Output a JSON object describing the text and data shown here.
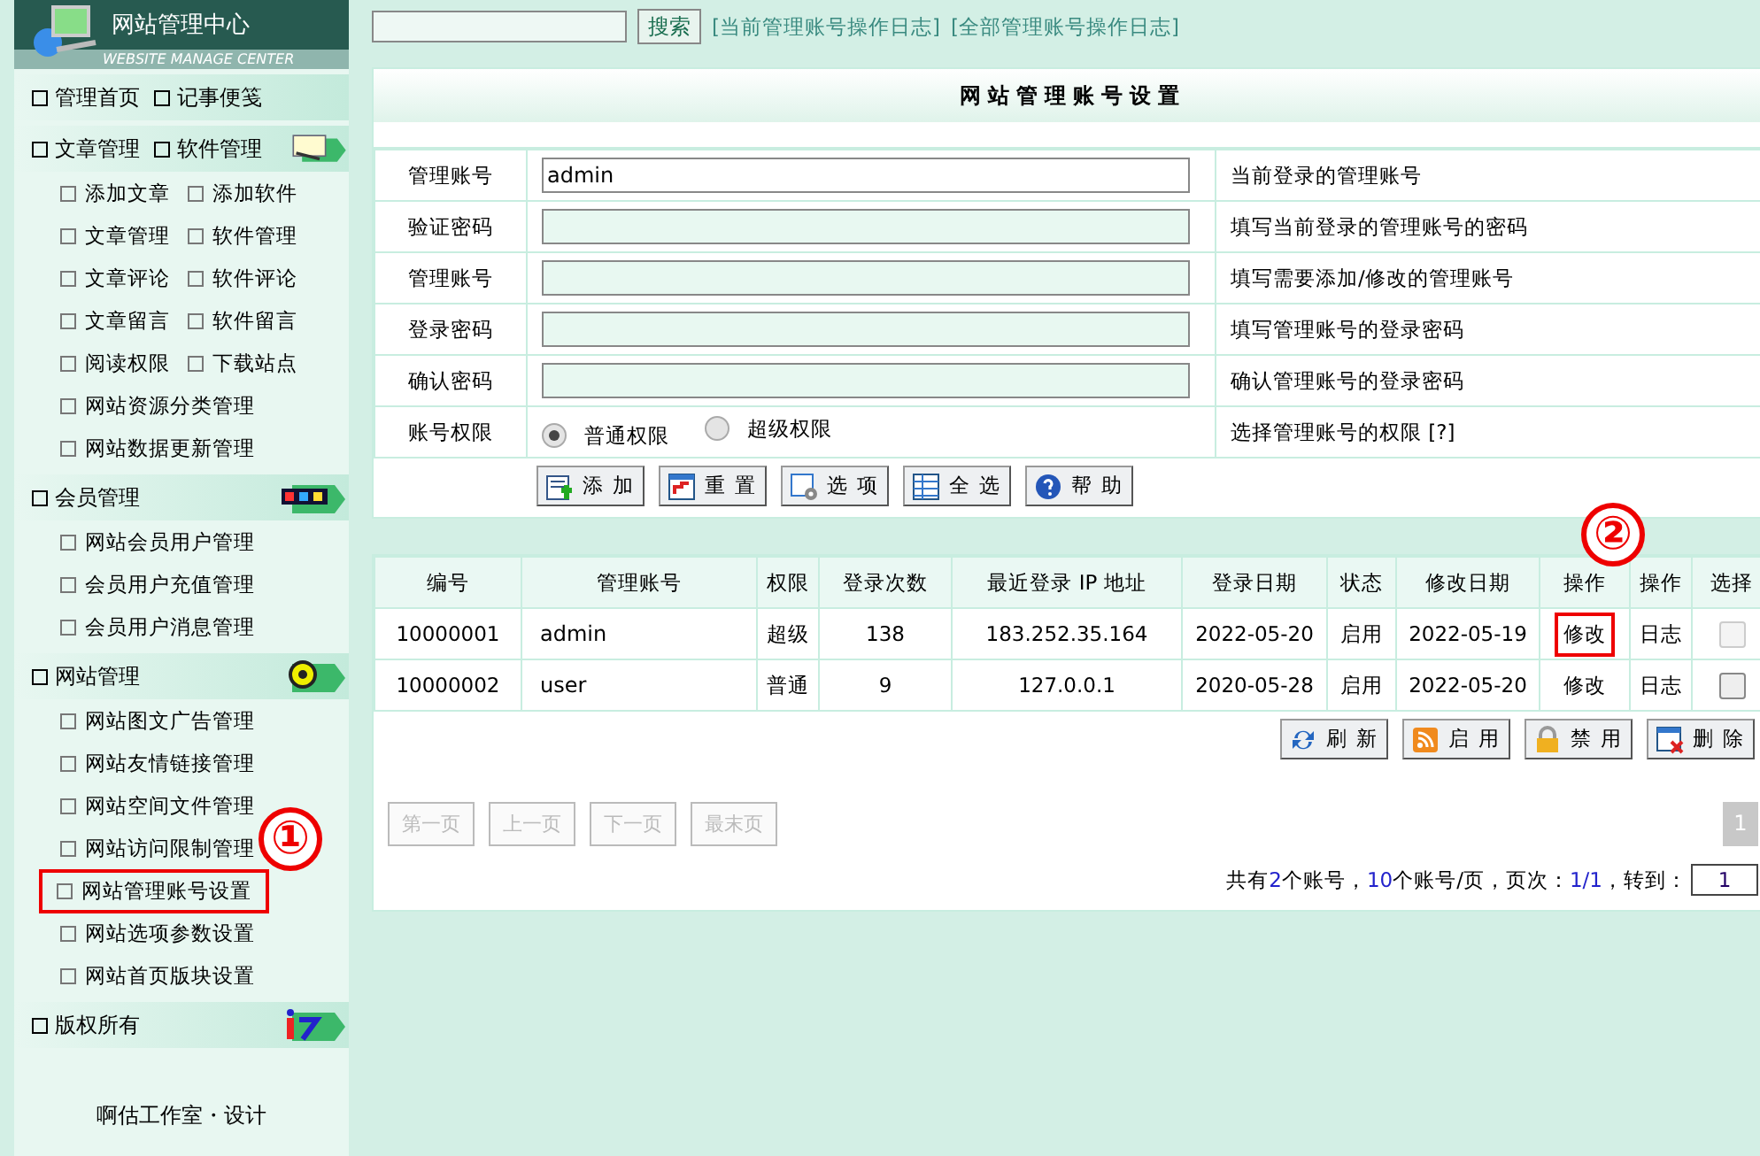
{
  "sidebar": {
    "title": "网站管理中心",
    "subtitle": "WEBSITE MANAGE CENTER",
    "sections": [
      {
        "items": [
          "管理首页",
          "记事便笺"
        ]
      },
      {
        "items": [
          "文章管理",
          "软件管理"
        ],
        "rows": [
          {
            "items": [
              {
                "label": "添加文章",
                "annotated": false
              },
              {
                "label": "添加软件",
                "annotated": false
              }
            ]
          },
          {
            "items": [
              {
                "label": "文章管理",
                "annotated": false
              },
              {
                "label": "软件管理",
                "annotated": false
              }
            ]
          },
          {
            "items": [
              {
                "label": "文章评论",
                "annotated": false
              },
              {
                "label": "软件评论",
                "annotated": false
              }
            ]
          },
          {
            "items": [
              {
                "label": "文章留言",
                "annotated": false
              },
              {
                "label": "软件留言",
                "annotated": false
              }
            ]
          },
          {
            "items": [
              {
                "label": "阅读权限",
                "annotated": false
              },
              {
                "label": "下载站点",
                "annotated": false
              }
            ]
          },
          {
            "items": [
              {
                "label": "网站资源分类管理",
                "annotated": false
              }
            ]
          },
          {
            "items": [
              {
                "label": "网站数据更新管理",
                "annotated": false
              }
            ]
          }
        ]
      },
      {
        "items": [
          "会员管理"
        ],
        "rows": [
          {
            "items": [
              {
                "label": "网站会员用户管理",
                "annotated": false
              }
            ]
          },
          {
            "items": [
              {
                "label": "会员用户充值管理",
                "annotated": false
              }
            ]
          },
          {
            "items": [
              {
                "label": "会员用户消息管理",
                "annotated": false
              }
            ]
          }
        ]
      },
      {
        "items": [
          "网站管理"
        ],
        "rows": [
          {
            "items": [
              {
                "label": "网站图文广告管理",
                "annotated": false
              }
            ]
          },
          {
            "items": [
              {
                "label": "网站友情链接管理",
                "annotated": false
              }
            ]
          },
          {
            "items": [
              {
                "label": "网站空间文件管理",
                "annotated": false
              }
            ]
          },
          {
            "items": [
              {
                "label": "网站访问限制管理",
                "annotated": false
              }
            ]
          },
          {
            "items": [
              {
                "label": "网站管理账号设置",
                "annotated": true
              }
            ]
          },
          {
            "items": [
              {
                "label": "网站选项参数设置",
                "annotated": false
              }
            ]
          },
          {
            "items": [
              {
                "label": "网站首页版块设置",
                "annotated": false
              }
            ]
          }
        ]
      },
      {
        "items": [
          "版权所有"
        ]
      }
    ],
    "footer": "啊估工作室・设计"
  },
  "topbar": {
    "search_button": "搜索",
    "links": [
      "[当前管理账号操作日志]",
      "[全部管理账号操作日志]"
    ]
  },
  "form": {
    "title": "网站管理账号设置",
    "fields": [
      {
        "kind": "text",
        "label": "管理账号",
        "value": "admin",
        "hint": "当前登录的管理账号"
      },
      {
        "kind": "text",
        "label": "验证密码",
        "hint": "填写当前登录的管理账号的密码"
      },
      {
        "kind": "text",
        "label": "管理账号",
        "hint": "填写需要添加/修改的管理账号"
      },
      {
        "kind": "text",
        "label": "登录密码",
        "hint": "填写管理账号的登录密码"
      },
      {
        "kind": "text",
        "label": "确认密码",
        "hint": "确认管理账号的登录密码"
      },
      {
        "kind": "radio",
        "label": "账号权限",
        "options": [
          {
            "label": "普通权限",
            "selected": true
          },
          {
            "label": "超级权限",
            "selected": false
          }
        ],
        "hint": "选择管理账号的权限 [?]"
      }
    ],
    "buttons": [
      "添加",
      "重置",
      "选项",
      "全选",
      "帮助"
    ]
  },
  "table": {
    "columns": [
      "编号",
      "管理账号",
      "权限",
      "登录次数",
      "最近登录 IP 地址",
      "登录日期",
      "状态",
      "修改日期",
      "操作",
      "操作",
      "选择"
    ],
    "rows": [
      {
        "cells": [
          "10000001",
          "admin",
          "超级",
          "138",
          "183.252.35.164",
          "2022-05-20",
          "启用",
          "2022-05-19"
        ],
        "edit": "修改",
        "edit_annotated": true,
        "log": "日志",
        "checked": false,
        "disabled": true
      },
      {
        "cells": [
          "10000002",
          "user",
          "普通",
          "9",
          "127.0.0.1",
          "2020-05-28",
          "启用",
          "2022-05-20"
        ],
        "edit": "修改",
        "edit_annotated": false,
        "log": "日志",
        "checked": false,
        "disabled": false
      }
    ],
    "buttons": [
      "刷新",
      "启用",
      "禁用",
      "删除"
    ]
  },
  "pagination": {
    "buttons": [
      {
        "label": "第一页",
        "disabled": true
      },
      {
        "label": "上一页",
        "disabled": true
      },
      {
        "label": "下一页",
        "disabled": true
      },
      {
        "label": "最末页",
        "disabled": true
      }
    ],
    "current": "1",
    "summary": [
      {
        "text": "共有",
        "highlight": false
      },
      {
        "text": "2",
        "highlight": true
      },
      {
        "text": "个账号，",
        "highlight": false
      },
      {
        "text": "10",
        "highlight": true
      },
      {
        "text": "个账号/页，页次：",
        "highlight": false
      },
      {
        "text": "1/1",
        "highlight": true
      },
      {
        "text": "，转到：",
        "highlight": false
      }
    ],
    "jump_value": "1"
  },
  "annotations": [
    "①",
    "②"
  ]
}
